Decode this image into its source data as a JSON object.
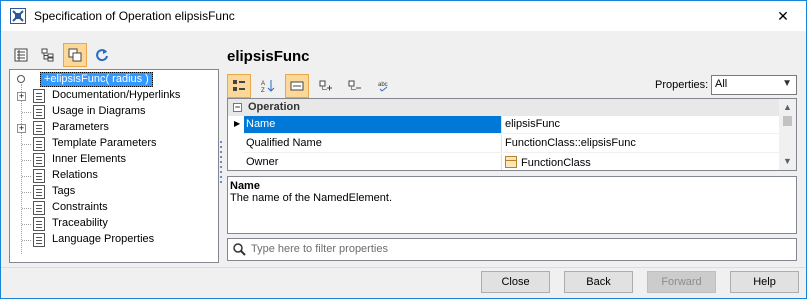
{
  "window": {
    "title": "Specification of Operation elipsisFunc",
    "close_glyph": "✕"
  },
  "left_toolbar": {
    "buttons": [
      {
        "name": "list-view-icon",
        "active": false
      },
      {
        "name": "tree-view-icon",
        "active": false
      },
      {
        "name": "copy-view-icon",
        "active": true
      },
      {
        "name": "refresh-icon",
        "active": false
      }
    ]
  },
  "tree": {
    "root": "+elipsisFunc( radius )",
    "items": [
      {
        "label": "Documentation/Hyperlinks",
        "expandable": true
      },
      {
        "label": "Usage in Diagrams",
        "expandable": false
      },
      {
        "label": "Parameters",
        "expandable": true
      },
      {
        "label": "Template Parameters",
        "expandable": false
      },
      {
        "label": "Inner Elements",
        "expandable": false
      },
      {
        "label": "Relations",
        "expandable": false
      },
      {
        "label": "Tags",
        "expandable": false
      },
      {
        "label": "Constraints",
        "expandable": false
      },
      {
        "label": "Traceability",
        "expandable": false
      },
      {
        "label": "Language Properties",
        "expandable": false
      }
    ]
  },
  "main": {
    "title": "elipsisFunc",
    "properties_label": "Properties:",
    "properties_value": "All",
    "group": "Operation",
    "rows": [
      {
        "key": "Name",
        "value": "elipsisFunc",
        "selected": true
      },
      {
        "key": "Qualified Name",
        "value": "FunctionClass::elipsisFunc",
        "selected": false
      },
      {
        "key": "Owner",
        "value": "FunctionClass",
        "selected": false
      }
    ],
    "description_title": "Name",
    "description_text": "The name of the NamedElement.",
    "filter_placeholder": "Type here to filter properties"
  },
  "buttons": {
    "close": "Close",
    "back": "Back",
    "forward": "Forward",
    "help": "Help"
  },
  "colors": {
    "accent": "#0078d7",
    "selection": "#3399ff",
    "active_tool": "#fbd89a"
  }
}
